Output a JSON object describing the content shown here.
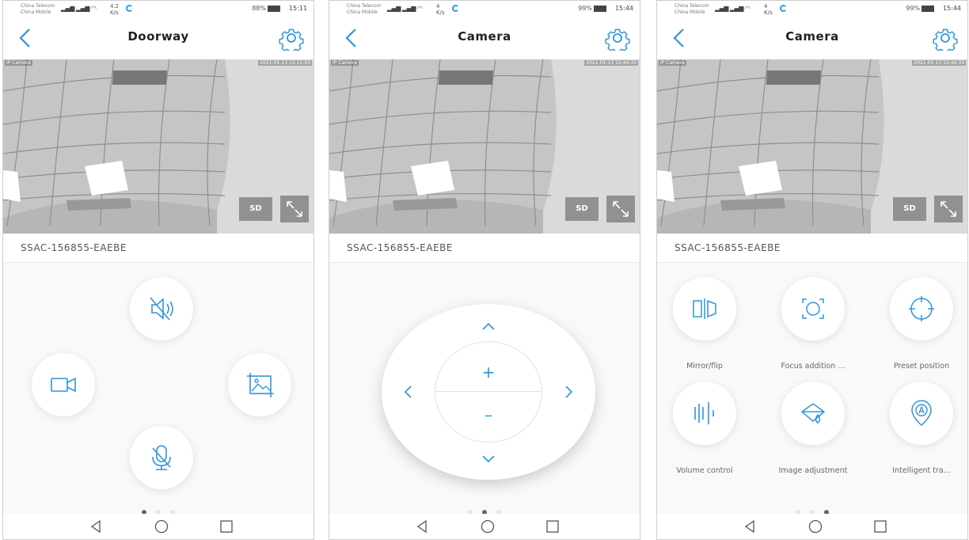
{
  "status": {
    "carrier1": "China Telecom",
    "carrier2": "China Mobile",
    "signal": "4G 2G",
    "screens": [
      {
        "speed_value": "4.2",
        "speed_unit": "K/s",
        "battery": "88%",
        "time": "15:11"
      },
      {
        "speed_value": "4",
        "speed_unit": "K/s",
        "battery": "99%",
        "time": "15:44"
      },
      {
        "speed_value": "4",
        "speed_unit": "K/s",
        "battery": "99%",
        "time": "15:44"
      }
    ]
  },
  "screens": [
    {
      "title": "Doorway",
      "timestamp": "2021-01-13 15:11:53"
    },
    {
      "title": "Camera",
      "timestamp": "2021-01-13 15:44:33"
    },
    {
      "title": "Camera",
      "timestamp": "2021-01-13 15:44:33"
    }
  ],
  "video": {
    "label": "IP Camera",
    "sd_label": "SD"
  },
  "device_name": "SSAC-156855-EAEBE",
  "ptz": {
    "zoom_in": "+",
    "zoom_out": "–"
  },
  "features": [
    {
      "label": "Mirror/flip",
      "icon": "mirror-flip-icon"
    },
    {
      "label": "Focus addition ...",
      "icon": "focus-icon"
    },
    {
      "label": "Preset position",
      "icon": "crosshair-icon"
    },
    {
      "label": "Volume control",
      "icon": "sound-bars-icon"
    },
    {
      "label": "Image adjustment",
      "icon": "image-adjust-icon"
    },
    {
      "label": "Intelligent tra...",
      "icon": "tracking-pin-icon"
    }
  ],
  "pager": {
    "active": [
      0,
      1,
      2
    ]
  },
  "colors": {
    "accent": "#2f95d8",
    "text": "#222222",
    "muted": "#666666"
  }
}
